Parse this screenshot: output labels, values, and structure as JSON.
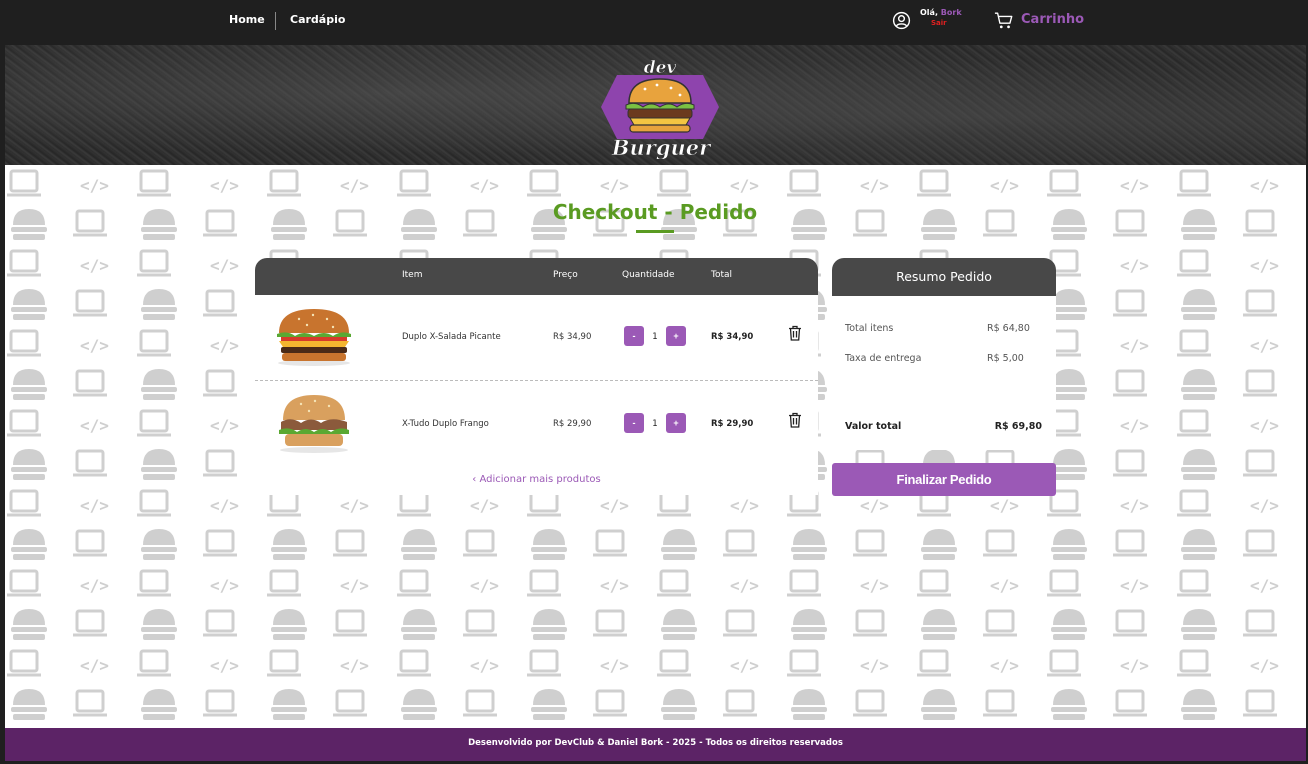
{
  "nav": {
    "home": "Home",
    "menu": "Cardápio",
    "greeting": "Olá,",
    "user_name": "Bork",
    "logout": "Sair",
    "cart": "Carrinho"
  },
  "logo": {
    "top_text": "dev",
    "bottom_text": "Burguer"
  },
  "page": {
    "title": "Checkout - Pedido"
  },
  "cart_table": {
    "headers": {
      "item": "Item",
      "price": "Preço",
      "quantity": "Quantidade",
      "total": "Total"
    },
    "rows": [
      {
        "name": "Duplo X-Salada Picante",
        "price": "R$ 34,90",
        "quantity": "1",
        "total": "R$ 34,90"
      },
      {
        "name": "X-Tudo Duplo Frango",
        "price": "R$ 29,90",
        "quantity": "1",
        "total": "R$ 29,90"
      }
    ],
    "minus_label": "-",
    "plus_label": "+",
    "add_more": "‹ Adicionar mais produtos"
  },
  "summary": {
    "title": "Resumo Pedido",
    "items_label": "Total itens",
    "items_value": "R$ 64,80",
    "delivery_label": "Taxa de entrega",
    "delivery_value": "R$ 5,00",
    "total_label": "Valor total",
    "total_value": "R$ 69,80",
    "checkout_button": "Finalizar Pedido"
  },
  "footer": {
    "text": "Desenvolvido por DevClub & Daniel Bork - 2025 - Todos os direitos reservados"
  },
  "colors": {
    "accent_purple": "#9b59b6",
    "title_green": "#5a9b22",
    "header_dark": "#1f1f1f",
    "table_head": "#484848",
    "footer_purple": "#5c2366",
    "logout_red": "#e02020"
  },
  "icons": [
    "user-circle-icon",
    "cart-icon",
    "trash-icon",
    "chevron-left-icon"
  ]
}
